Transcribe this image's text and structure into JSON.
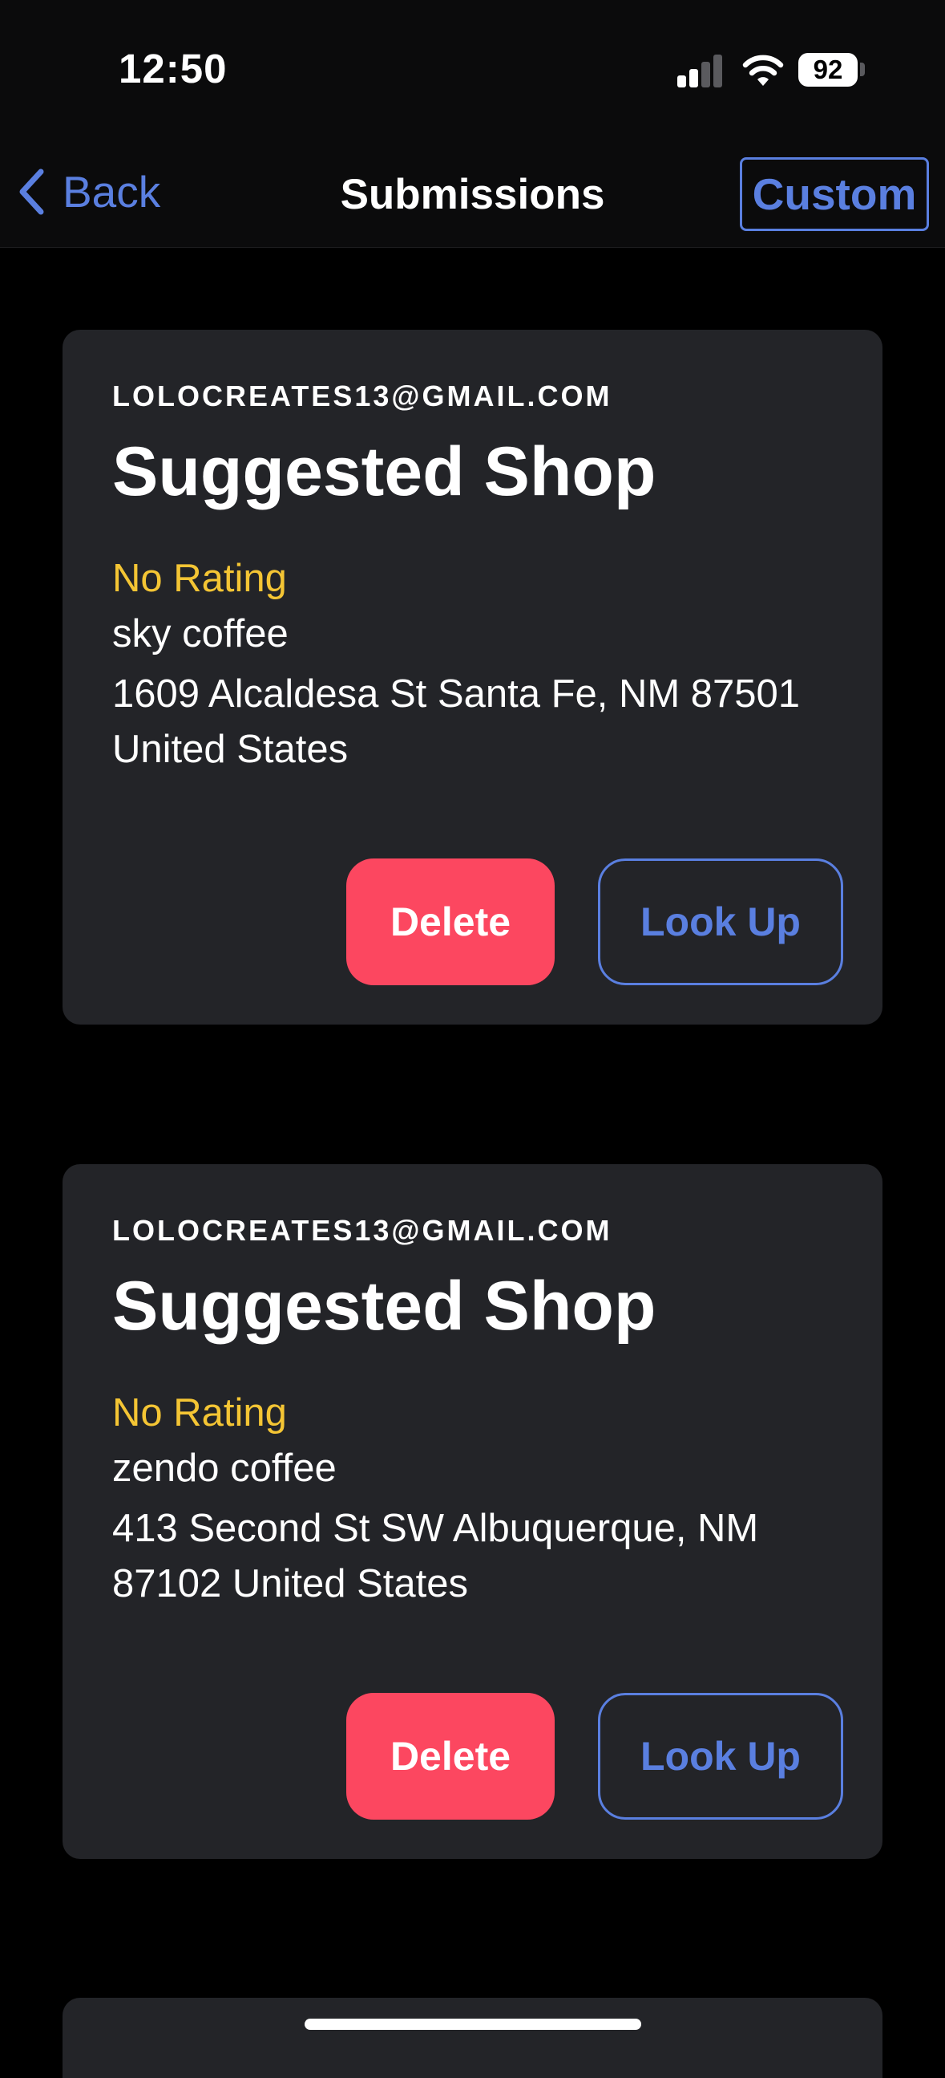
{
  "status_bar": {
    "time": "12:50",
    "battery": "92",
    "icons": [
      "cellular-signal-icon",
      "wifi-icon",
      "battery-icon"
    ]
  },
  "nav": {
    "back_label": "Back",
    "title": "Submissions",
    "custom_label": "Custom"
  },
  "colors": {
    "accent": "#5a7fe0",
    "delete": "#fc4760",
    "rating": "#f4c534",
    "card": "#232428",
    "background": "#000000"
  },
  "submissions": [
    {
      "email": "LOLOCREATES13@GMAIL.COM",
      "title": "Suggested Shop",
      "rating": "No Rating",
      "shop_name": "sky coffee",
      "address": "1609 Alcaldesa St Santa Fe, NM 87501 United States",
      "delete_label": "Delete",
      "lookup_label": "Look Up"
    },
    {
      "email": "LOLOCREATES13@GMAIL.COM",
      "title": "Suggested Shop",
      "rating": "No Rating",
      "shop_name": "zendo coffee",
      "address": "413 Second St SW Albuquerque, NM 87102 United States",
      "delete_label": "Delete",
      "lookup_label": "Look Up"
    }
  ]
}
